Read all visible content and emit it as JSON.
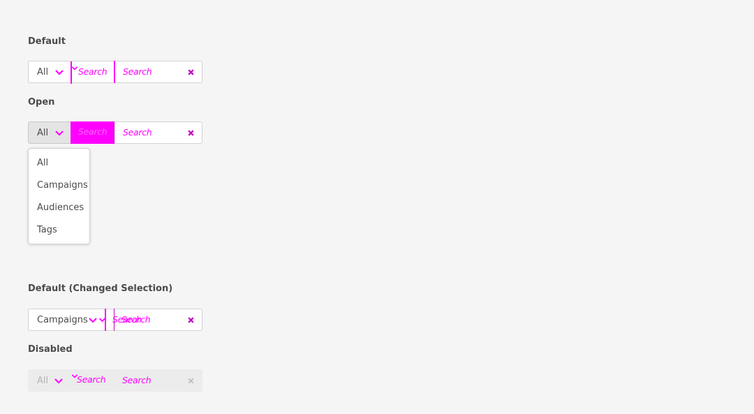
{
  "sections": {
    "default": {
      "title": "Default",
      "picker_value": "All",
      "picker_search": "Search",
      "field_placeholder": "Search"
    },
    "open": {
      "title": "Open",
      "picker_value": "All",
      "picker_search": "Search",
      "field_placeholder": "Search",
      "menu_items": [
        "All",
        "Campaigns",
        "Audiences",
        "Tags"
      ]
    },
    "changed": {
      "title": "Default (Changed Selection)",
      "picker_value": "Campaigns",
      "picker_search": "Search",
      "field_placeholder": "Search"
    },
    "disabled": {
      "title": "Disabled",
      "picker_value": "All",
      "picker_search": "Search",
      "field_placeholder": "Search"
    }
  },
  "icons": {
    "chevron": "chevron-down-icon",
    "clear": "close-icon"
  },
  "colors": {
    "background": "#f5f5f5",
    "accent": "#ff00ff",
    "border": "#d3d3d3",
    "text": "#4b4b4b",
    "disabled_bg": "#ececec"
  }
}
